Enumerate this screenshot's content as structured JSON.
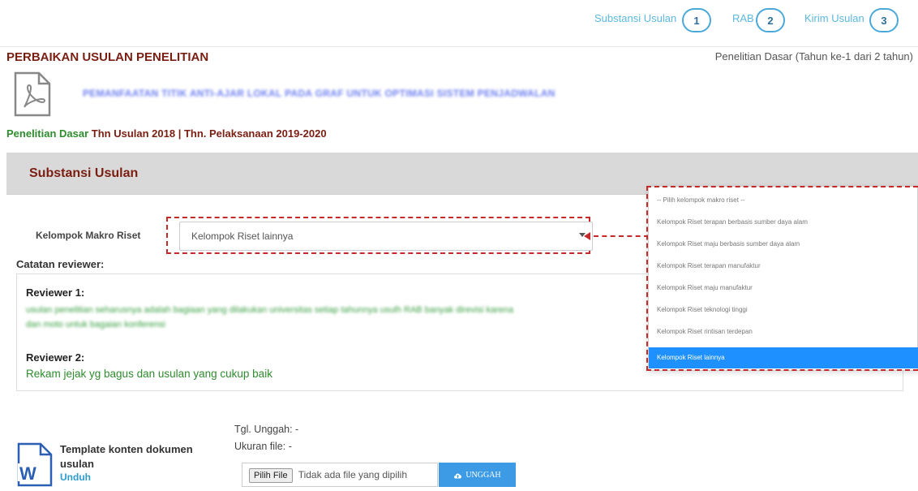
{
  "steps": [
    {
      "label": "Substansi Usulan",
      "num": "1"
    },
    {
      "label": "RAB",
      "num": "2"
    },
    {
      "label": "Kirim Usulan",
      "num": "3"
    }
  ],
  "header": {
    "title": "PERBAIKAN USULAN PENELITIAN",
    "scheme_info": "Penelitian Dasar (Tahun ke-1 dari 2 tahun)"
  },
  "proposal": {
    "title_blurred": "PEMANFAATAN TITIK ANTI-AJAR LOKAL PADA GRAF UNTUK OPTIMASI SISTEM PENJADWALAN"
  },
  "meta": {
    "scheme": "Penelitian Dasar",
    "years": "Thn Usulan 2018 | Thn. Pelaksanaan 2019-2020"
  },
  "section": {
    "title": "Substansi Usulan"
  },
  "makro": {
    "label": "Kelompok Makro Riset",
    "selected": "Kelompok Riset lainnya",
    "options": [
      "-- Pilih kelompok makro riset --",
      "Kelompok Riset terapan berbasis sumber daya alam",
      "Kelompok Riset maju berbasis sumber daya alam",
      "Kelompok Riset terapan manufaktur",
      "Kelompok Riset maju manufaktur",
      "Kelompok Riset teknologi tinggi",
      "Kelompok Riset rintisan terdepan",
      "Kelompok Riset lainnya"
    ]
  },
  "reviews": {
    "heading": "Catatan reviewer:",
    "r1_label": "Reviewer 1:",
    "r1_blurred_a": "usulan penelitian seharusnya adalah bagiaan yang dilakukan universitas setiap tahunnya usulh RAB banyak direvisi karena",
    "r1_blurred_b": "dan moto untuk bagaian konferensi",
    "r2_label": "Reviewer 2:",
    "r2_text": "Rekam jejak yg bagus dan usulan yang cukup baik"
  },
  "upload": {
    "template_label": "Template konten dokumen usulan",
    "unduh": "Unduh",
    "tgl": "Tgl. Unggah: -",
    "ukuran": "Ukuran file: -",
    "choose_btn": "Pilih File",
    "no_file": "Tidak ada file yang dipilih",
    "upload_btn": "UNGGAH"
  },
  "colors": {
    "accent_blue": "#3d9be6",
    "title_red": "#7a1e12",
    "green": "#2e8b2e",
    "highlight_dash": "#c42a2a"
  }
}
